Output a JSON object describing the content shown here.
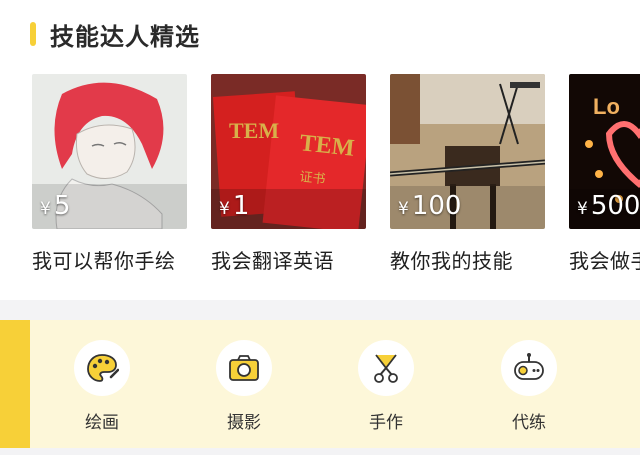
{
  "section": {
    "title": "技能达人精选"
  },
  "cards": [
    {
      "price_symbol": "¥",
      "price": "5",
      "title": "我可以帮你手绘"
    },
    {
      "price_symbol": "¥",
      "price": "1",
      "title": "我会翻译英语",
      "thumb_text": "TEM",
      "thumb_sub": "证书"
    },
    {
      "price_symbol": "¥",
      "price": "100",
      "title": "教你我的技能"
    },
    {
      "price_symbol": "¥",
      "price": "500",
      "title": "我会做手",
      "thumb_text": "Lo"
    }
  ],
  "categories": [
    {
      "label": "绘画",
      "icon": "palette-icon"
    },
    {
      "label": "摄影",
      "icon": "camera-icon"
    },
    {
      "label": "手作",
      "icon": "scissors-icon"
    },
    {
      "label": "代练",
      "icon": "gamepad-icon"
    }
  ],
  "colors": {
    "accent": "#f7d038",
    "category_bg": "#fdf7d9"
  }
}
